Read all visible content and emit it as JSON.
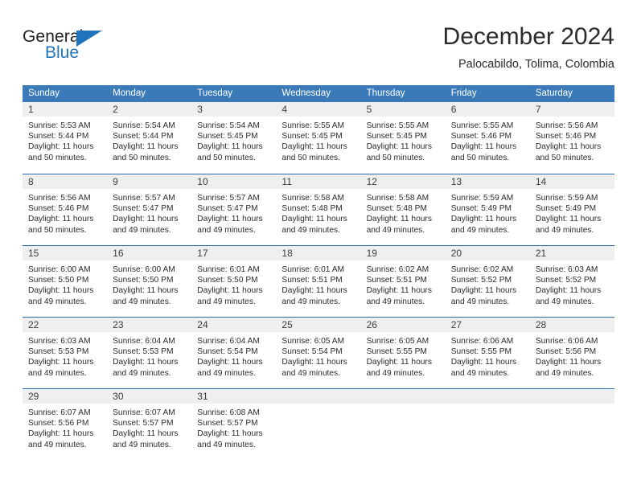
{
  "brand": {
    "line1": "General",
    "line2": "Blue",
    "accent_color": "#1f74bb"
  },
  "header": {
    "title": "December 2024",
    "subtitle": "Palocabildo, Tolima, Colombia"
  },
  "theme": {
    "header_blue": "#3a7ab8",
    "row_divider_blue": "#2d6ca8",
    "day_band_gray": "#efefef"
  },
  "weekdays": [
    "Sunday",
    "Monday",
    "Tuesday",
    "Wednesday",
    "Thursday",
    "Friday",
    "Saturday"
  ],
  "weeks": [
    [
      {
        "day": "1",
        "sunrise": "Sunrise: 5:53 AM",
        "sunset": "Sunset: 5:44 PM",
        "daylight": "Daylight: 11 hours and 50 minutes."
      },
      {
        "day": "2",
        "sunrise": "Sunrise: 5:54 AM",
        "sunset": "Sunset: 5:44 PM",
        "daylight": "Daylight: 11 hours and 50 minutes."
      },
      {
        "day": "3",
        "sunrise": "Sunrise: 5:54 AM",
        "sunset": "Sunset: 5:45 PM",
        "daylight": "Daylight: 11 hours and 50 minutes."
      },
      {
        "day": "4",
        "sunrise": "Sunrise: 5:55 AM",
        "sunset": "Sunset: 5:45 PM",
        "daylight": "Daylight: 11 hours and 50 minutes."
      },
      {
        "day": "5",
        "sunrise": "Sunrise: 5:55 AM",
        "sunset": "Sunset: 5:45 PM",
        "daylight": "Daylight: 11 hours and 50 minutes."
      },
      {
        "day": "6",
        "sunrise": "Sunrise: 5:55 AM",
        "sunset": "Sunset: 5:46 PM",
        "daylight": "Daylight: 11 hours and 50 minutes."
      },
      {
        "day": "7",
        "sunrise": "Sunrise: 5:56 AM",
        "sunset": "Sunset: 5:46 PM",
        "daylight": "Daylight: 11 hours and 50 minutes."
      }
    ],
    [
      {
        "day": "8",
        "sunrise": "Sunrise: 5:56 AM",
        "sunset": "Sunset: 5:46 PM",
        "daylight": "Daylight: 11 hours and 50 minutes."
      },
      {
        "day": "9",
        "sunrise": "Sunrise: 5:57 AM",
        "sunset": "Sunset: 5:47 PM",
        "daylight": "Daylight: 11 hours and 49 minutes."
      },
      {
        "day": "10",
        "sunrise": "Sunrise: 5:57 AM",
        "sunset": "Sunset: 5:47 PM",
        "daylight": "Daylight: 11 hours and 49 minutes."
      },
      {
        "day": "11",
        "sunrise": "Sunrise: 5:58 AM",
        "sunset": "Sunset: 5:48 PM",
        "daylight": "Daylight: 11 hours and 49 minutes."
      },
      {
        "day": "12",
        "sunrise": "Sunrise: 5:58 AM",
        "sunset": "Sunset: 5:48 PM",
        "daylight": "Daylight: 11 hours and 49 minutes."
      },
      {
        "day": "13",
        "sunrise": "Sunrise: 5:59 AM",
        "sunset": "Sunset: 5:49 PM",
        "daylight": "Daylight: 11 hours and 49 minutes."
      },
      {
        "day": "14",
        "sunrise": "Sunrise: 5:59 AM",
        "sunset": "Sunset: 5:49 PM",
        "daylight": "Daylight: 11 hours and 49 minutes."
      }
    ],
    [
      {
        "day": "15",
        "sunrise": "Sunrise: 6:00 AM",
        "sunset": "Sunset: 5:50 PM",
        "daylight": "Daylight: 11 hours and 49 minutes."
      },
      {
        "day": "16",
        "sunrise": "Sunrise: 6:00 AM",
        "sunset": "Sunset: 5:50 PM",
        "daylight": "Daylight: 11 hours and 49 minutes."
      },
      {
        "day": "17",
        "sunrise": "Sunrise: 6:01 AM",
        "sunset": "Sunset: 5:50 PM",
        "daylight": "Daylight: 11 hours and 49 minutes."
      },
      {
        "day": "18",
        "sunrise": "Sunrise: 6:01 AM",
        "sunset": "Sunset: 5:51 PM",
        "daylight": "Daylight: 11 hours and 49 minutes."
      },
      {
        "day": "19",
        "sunrise": "Sunrise: 6:02 AM",
        "sunset": "Sunset: 5:51 PM",
        "daylight": "Daylight: 11 hours and 49 minutes."
      },
      {
        "day": "20",
        "sunrise": "Sunrise: 6:02 AM",
        "sunset": "Sunset: 5:52 PM",
        "daylight": "Daylight: 11 hours and 49 minutes."
      },
      {
        "day": "21",
        "sunrise": "Sunrise: 6:03 AM",
        "sunset": "Sunset: 5:52 PM",
        "daylight": "Daylight: 11 hours and 49 minutes."
      }
    ],
    [
      {
        "day": "22",
        "sunrise": "Sunrise: 6:03 AM",
        "sunset": "Sunset: 5:53 PM",
        "daylight": "Daylight: 11 hours and 49 minutes."
      },
      {
        "day": "23",
        "sunrise": "Sunrise: 6:04 AM",
        "sunset": "Sunset: 5:53 PM",
        "daylight": "Daylight: 11 hours and 49 minutes."
      },
      {
        "day": "24",
        "sunrise": "Sunrise: 6:04 AM",
        "sunset": "Sunset: 5:54 PM",
        "daylight": "Daylight: 11 hours and 49 minutes."
      },
      {
        "day": "25",
        "sunrise": "Sunrise: 6:05 AM",
        "sunset": "Sunset: 5:54 PM",
        "daylight": "Daylight: 11 hours and 49 minutes."
      },
      {
        "day": "26",
        "sunrise": "Sunrise: 6:05 AM",
        "sunset": "Sunset: 5:55 PM",
        "daylight": "Daylight: 11 hours and 49 minutes."
      },
      {
        "day": "27",
        "sunrise": "Sunrise: 6:06 AM",
        "sunset": "Sunset: 5:55 PM",
        "daylight": "Daylight: 11 hours and 49 minutes."
      },
      {
        "day": "28",
        "sunrise": "Sunrise: 6:06 AM",
        "sunset": "Sunset: 5:56 PM",
        "daylight": "Daylight: 11 hours and 49 minutes."
      }
    ],
    [
      {
        "day": "29",
        "sunrise": "Sunrise: 6:07 AM",
        "sunset": "Sunset: 5:56 PM",
        "daylight": "Daylight: 11 hours and 49 minutes."
      },
      {
        "day": "30",
        "sunrise": "Sunrise: 6:07 AM",
        "sunset": "Sunset: 5:57 PM",
        "daylight": "Daylight: 11 hours and 49 minutes."
      },
      {
        "day": "31",
        "sunrise": "Sunrise: 6:08 AM",
        "sunset": "Sunset: 5:57 PM",
        "daylight": "Daylight: 11 hours and 49 minutes."
      },
      {
        "day": "",
        "sunrise": "",
        "sunset": "",
        "daylight": ""
      },
      {
        "day": "",
        "sunrise": "",
        "sunset": "",
        "daylight": ""
      },
      {
        "day": "",
        "sunrise": "",
        "sunset": "",
        "daylight": ""
      },
      {
        "day": "",
        "sunrise": "",
        "sunset": "",
        "daylight": ""
      }
    ]
  ]
}
